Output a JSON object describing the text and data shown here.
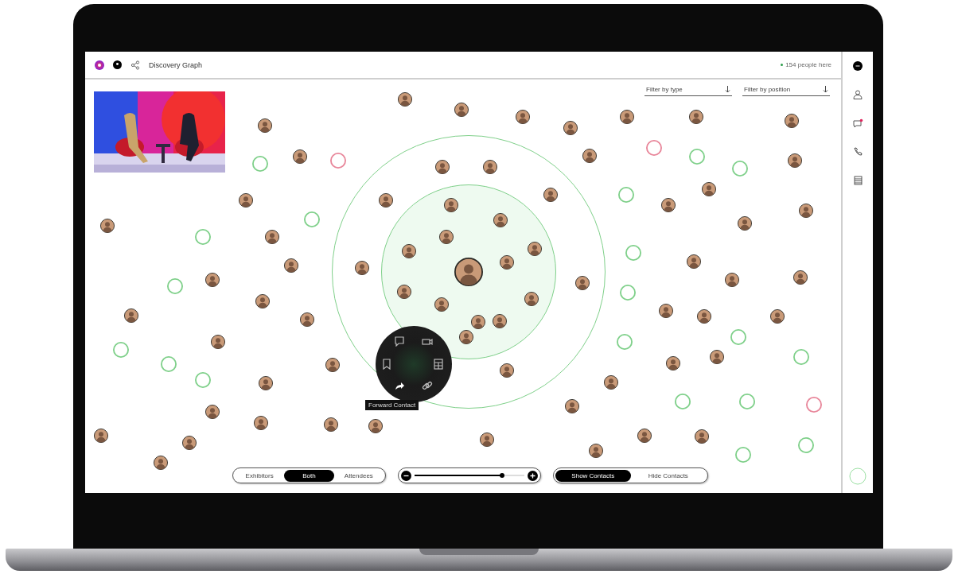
{
  "header": {
    "title": "Discovery Graph",
    "presence": "154 people here"
  },
  "filters": [
    {
      "label": "Filter by type"
    },
    {
      "label": "Filter by position"
    }
  ],
  "graph": {
    "nodes": [
      {
        "kind": "focus"
      },
      {
        "kind": "avatar"
      },
      {
        "kind": "avatar"
      },
      {
        "kind": "avatar"
      },
      {
        "kind": "avatar"
      },
      {
        "kind": "avatar"
      },
      {
        "kind": "avatar"
      },
      {
        "kind": "avatar"
      },
      {
        "kind": "avatar"
      },
      {
        "kind": "avatar"
      },
      {
        "kind": "avatar"
      },
      {
        "kind": "avatar"
      },
      {
        "kind": "avatar"
      },
      {
        "kind": "avatar"
      },
      {
        "kind": "avatar"
      },
      {
        "kind": "avatar"
      },
      {
        "kind": "avatar"
      },
      {
        "kind": "avatar"
      },
      {
        "kind": "avatar"
      },
      {
        "kind": "avatar"
      },
      {
        "kind": "avatar"
      },
      {
        "kind": "avatar"
      },
      {
        "kind": "avatar"
      },
      {
        "kind": "avatar"
      },
      {
        "kind": "avatar"
      },
      {
        "kind": "avatar"
      },
      {
        "kind": "avatar"
      },
      {
        "kind": "avatar"
      },
      {
        "kind": "avatar"
      },
      {
        "kind": "avatar"
      },
      {
        "kind": "avatar"
      },
      {
        "kind": "avatar"
      },
      {
        "kind": "avatar"
      },
      {
        "kind": "avatar"
      },
      {
        "kind": "avatar"
      },
      {
        "kind": "avatar"
      },
      {
        "kind": "avatar"
      },
      {
        "kind": "avatar"
      },
      {
        "kind": "avatar"
      },
      {
        "kind": "avatar"
      },
      {
        "kind": "avatar"
      },
      {
        "kind": "avatar"
      },
      {
        "kind": "avatar"
      },
      {
        "kind": "avatar"
      },
      {
        "kind": "avatar"
      },
      {
        "kind": "avatar"
      },
      {
        "kind": "avatar"
      },
      {
        "kind": "avatar"
      },
      {
        "kind": "avatar"
      },
      {
        "kind": "avatar"
      },
      {
        "kind": "avatar"
      },
      {
        "kind": "avatar"
      },
      {
        "kind": "avatar"
      },
      {
        "kind": "avatar"
      },
      {
        "kind": "avatar"
      },
      {
        "kind": "avatar"
      },
      {
        "kind": "avatar"
      },
      {
        "kind": "avatar"
      },
      {
        "kind": "avatar"
      },
      {
        "kind": "avatar"
      },
      {
        "kind": "avatar"
      },
      {
        "kind": "avatar"
      },
      {
        "kind": "avatar"
      },
      {
        "kind": "avatar"
      },
      {
        "kind": "avatar"
      },
      {
        "kind": "avatar"
      },
      {
        "kind": "avatar"
      },
      {
        "kind": "ring",
        "color": "#7fd08a"
      },
      {
        "kind": "ring",
        "color": "#7fd08a"
      },
      {
        "kind": "ring",
        "color": "#7fd08a"
      },
      {
        "kind": "ring",
        "color": "#7fd08a"
      },
      {
        "kind": "ring",
        "color": "#7fd08a"
      },
      {
        "kind": "ring",
        "color": "#7fd08a"
      },
      {
        "kind": "ring",
        "color": "#7fd08a"
      },
      {
        "kind": "ring",
        "color": "#7fd08a"
      },
      {
        "kind": "ring",
        "color": "#7fd08a"
      },
      {
        "kind": "ring",
        "color": "#7fd08a"
      },
      {
        "kind": "ring",
        "color": "#7fd08a"
      },
      {
        "kind": "ring",
        "color": "#7fd08a"
      },
      {
        "kind": "ring",
        "color": "#7fd08a"
      },
      {
        "kind": "ring",
        "color": "#7fd08a"
      },
      {
        "kind": "ring",
        "color": "#7fd08a"
      },
      {
        "kind": "ring",
        "color": "#7fd08a"
      },
      {
        "kind": "ring",
        "color": "#7fd08a"
      },
      {
        "kind": "ring",
        "color": "#7fd08a"
      },
      {
        "kind": "ring",
        "color": "#7fd08a"
      },
      {
        "kind": "ring",
        "color": "#e8869a"
      },
      {
        "kind": "ring",
        "color": "#e8869a"
      },
      {
        "kind": "ring",
        "color": "#e8869a"
      }
    ]
  },
  "action_menu": {
    "tooltip": "Forward Contact"
  },
  "audience_switch": [
    {
      "label": "Exhibitors",
      "selected": false
    },
    {
      "label": "Both",
      "selected": true
    },
    {
      "label": "Attendees",
      "selected": false
    }
  ],
  "zoom_slider": {
    "level": 0.8
  },
  "contacts_switch": [
    {
      "label": "Show Contacts",
      "selected": true
    },
    {
      "label": "Hide Contacts",
      "selected": false
    }
  ]
}
